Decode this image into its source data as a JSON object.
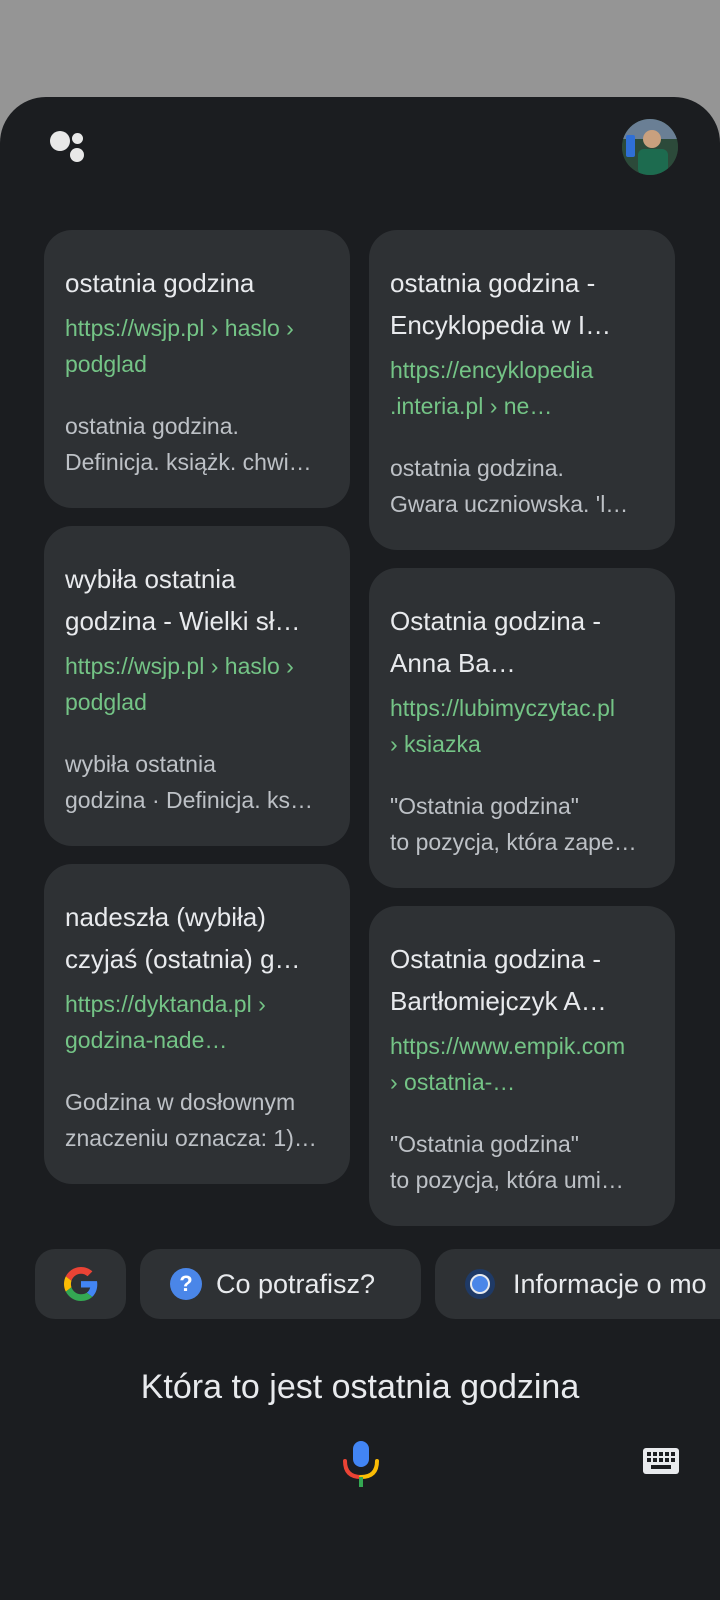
{
  "results": {
    "left": [
      {
        "title": "ostatnia godzina",
        "url_lines": [
          "https://wsjp.pl › haslo ›",
          "podglad"
        ],
        "snippet_lines": [
          "ostatnia godzina.",
          "Definicja. książk. chwi…"
        ]
      },
      {
        "title": "wybiła ostatnia godzina - Wielki sł…",
        "url_lines": [
          "https://wsjp.pl › haslo ›",
          "podglad"
        ],
        "snippet_lines": [
          "wybiła ostatnia",
          "godzina · Definicja. ks…"
        ]
      },
      {
        "title": "nadeszła (wybiła) czyjaś (ostatnia) g…",
        "url_lines": [
          "https://dyktanda.pl ›",
          "godzina-nade…"
        ],
        "snippet_lines": [
          "Godzina w dosłownym",
          "znaczeniu oznacza: 1)…"
        ]
      }
    ],
    "right": [
      {
        "title": "ostatnia godzina - Encyklopedia w I…",
        "url_lines": [
          "https://encyklopedia",
          ".interia.pl › ne…"
        ],
        "snippet_lines": [
          "ostatnia godzina.",
          "Gwara uczniowska. 'l…"
        ]
      },
      {
        "title": "Ostatnia godzina - Anna Ba…",
        "url_lines": [
          "https://lubimyczytac.pl",
          "› ksiazka"
        ],
        "snippet_lines": [
          "\"Ostatnia godzina\"",
          "to pozycja, która zape…"
        ]
      },
      {
        "title": "Ostatnia godzina - Bartłomiejczyk A…",
        "url_lines": [
          "https://www.empik.com",
          "› ostatnia-…"
        ],
        "snippet_lines": [
          "\"Ostatnia godzina\"",
          "to pozycja, która umi…"
        ]
      }
    ]
  },
  "chips": {
    "help_label": "Co potrafisz?",
    "info_label": "Informacje o mo"
  },
  "query_text": "Która to jest ostatnia godzina",
  "colors": {
    "background": "#1b1d20",
    "card": "#2e3134",
    "url_green": "#74c486",
    "accent_blue": "#4a86e8"
  },
  "icons": [
    "assistant-logo-icon",
    "google-g-icon",
    "help-icon",
    "info-dot-icon",
    "microphone-icon",
    "keyboard-icon"
  ]
}
